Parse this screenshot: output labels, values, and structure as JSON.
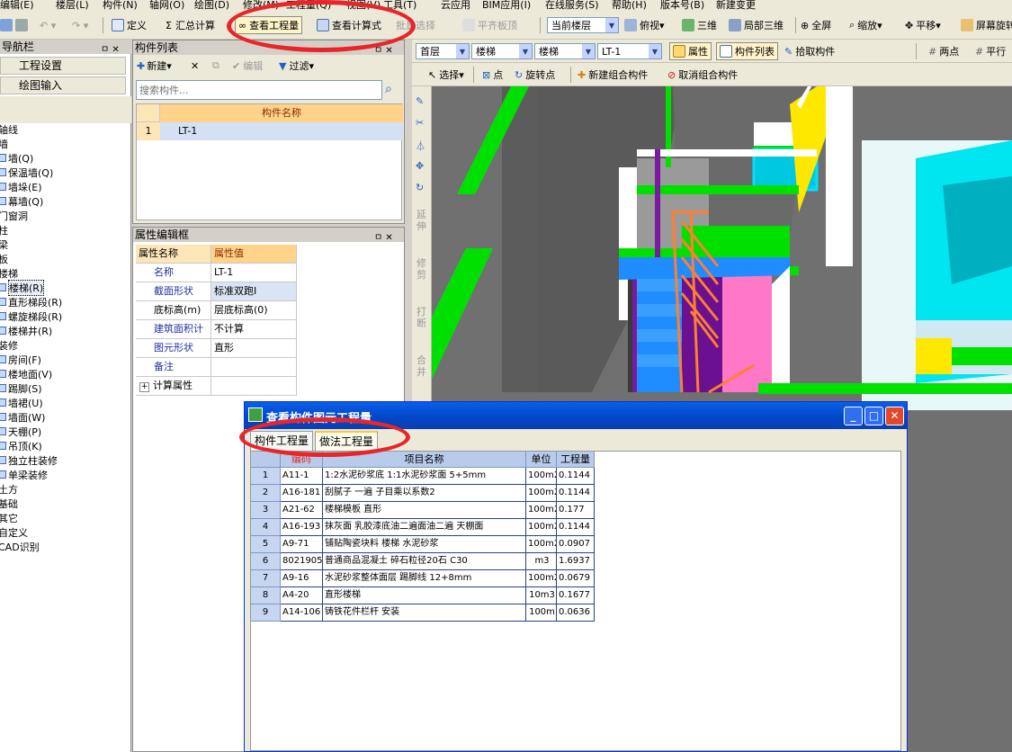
{
  "menubar": [
    "编辑(E)",
    "楼层(L)",
    "构件(N)",
    "轴网(O)",
    "绘图(D)",
    "修改(M)",
    "工程量(Q)",
    "视图(V)",
    "工具(T)",
    "云应用",
    "BIM应用(I)",
    "在线服务(S)",
    "帮助(H)",
    "版本号(B)",
    "新建变更"
  ],
  "toolbar1": {
    "define": "定义",
    "sum_calc": "汇总计算",
    "view_quantity": "查看工程量",
    "view_formula": "查看计算式",
    "batch_select": "批量选择",
    "align_top": "平齐板顶",
    "floor_combo": "当前楼层",
    "top_view": "俯视",
    "three_d": "三维",
    "local_3d": "局部三维",
    "fullscreen": "全屏",
    "zoom": "缩放",
    "pan": "平移",
    "screen_rotate": "屏幕旋转"
  },
  "toolbar2": {
    "floor": "首层",
    "cat1": "楼梯",
    "cat2": "楼梯",
    "component": "LT-1",
    "properties": "属性",
    "component_list": "构件列表",
    "pick_component": "拾取构件",
    "two_points": "两点",
    "parallel": "平行"
  },
  "toolbar3": {
    "select": "选择",
    "point": "点",
    "rotate_point": "旋转点",
    "new_combo": "新建组合构件",
    "cancel_combo": "取消组合构件"
  },
  "left_panel": {
    "title": "导航栏",
    "project_settings": "工程设置",
    "drawing_input": "绘图输入",
    "tree": [
      {
        "label": "轴线",
        "indent": 0,
        "icon": false
      },
      {
        "label": "墙",
        "indent": 0,
        "icon": false
      },
      {
        "label": "墙(Q)",
        "indent": 1,
        "icon": true
      },
      {
        "label": "保温墙(Q)",
        "indent": 1,
        "icon": true
      },
      {
        "label": "墙垛(E)",
        "indent": 1,
        "icon": true
      },
      {
        "label": "幕墙(Q)",
        "indent": 1,
        "icon": true
      },
      {
        "label": "门窗洞",
        "indent": 0,
        "icon": false
      },
      {
        "label": "柱",
        "indent": 0,
        "icon": false
      },
      {
        "label": "梁",
        "indent": 0,
        "icon": false
      },
      {
        "label": "板",
        "indent": 0,
        "icon": false
      },
      {
        "label": "楼梯",
        "indent": 0,
        "icon": false
      },
      {
        "label": "楼梯(R)",
        "indent": 1,
        "icon": true,
        "selected": true
      },
      {
        "label": "直形梯段(R)",
        "indent": 1,
        "icon": true
      },
      {
        "label": "螺旋梯段(R)",
        "indent": 1,
        "icon": true
      },
      {
        "label": "楼梯井(R)",
        "indent": 1,
        "icon": true
      },
      {
        "label": "装修",
        "indent": 0,
        "icon": false
      },
      {
        "label": "房间(F)",
        "indent": 1,
        "icon": true
      },
      {
        "label": "楼地面(V)",
        "indent": 1,
        "icon": true
      },
      {
        "label": "踢脚(S)",
        "indent": 1,
        "icon": true
      },
      {
        "label": "墙裙(U)",
        "indent": 1,
        "icon": true
      },
      {
        "label": "墙面(W)",
        "indent": 1,
        "icon": true
      },
      {
        "label": "天棚(P)",
        "indent": 1,
        "icon": true
      },
      {
        "label": "吊顶(K)",
        "indent": 1,
        "icon": true
      },
      {
        "label": "独立柱装修",
        "indent": 1,
        "icon": true
      },
      {
        "label": "单梁装修",
        "indent": 1,
        "icon": true
      },
      {
        "label": "土方",
        "indent": 0,
        "icon": false
      },
      {
        "label": "基础",
        "indent": 0,
        "icon": false
      },
      {
        "label": "其它",
        "indent": 0,
        "icon": false
      },
      {
        "label": "自定义",
        "indent": 0,
        "icon": false
      },
      {
        "label": "CAD识别",
        "indent": 0,
        "icon": false
      }
    ]
  },
  "component_list": {
    "title": "构件列表",
    "new": "新建",
    "edit": "编辑",
    "filter": "过滤",
    "search_placeholder": "搜索构件...",
    "header": "构件名称",
    "rows": [
      {
        "no": "1",
        "name": "LT-1"
      }
    ]
  },
  "property_editor": {
    "title": "属性编辑框",
    "col_name": "属性名称",
    "col_value": "属性值",
    "rows": [
      {
        "name": "名称",
        "value": "LT-1",
        "blue": true
      },
      {
        "name": "截面形状",
        "value": "标准双跑I",
        "blue": true
      },
      {
        "name": "底标高(m)",
        "value": "层底标高(0)",
        "blue": false
      },
      {
        "name": "建筑面积计",
        "value": "不计算",
        "blue": true
      },
      {
        "name": "图元形状",
        "value": "直形",
        "blue": true
      },
      {
        "name": "备注",
        "value": "",
        "blue": true
      },
      {
        "name": "计算属性",
        "value": "",
        "blue": false,
        "expander": "+"
      }
    ]
  },
  "vtools": [
    "延伸",
    "修剪",
    "打断",
    "合并"
  ],
  "dialog": {
    "title": "查看构件图元工程量",
    "tabs": [
      "构件工程量",
      "做法工程量"
    ],
    "active_tab": 1,
    "columns": [
      "编码",
      "项目名称",
      "单位",
      "工程量"
    ],
    "rows": [
      {
        "no": "1",
        "code": "A11-1",
        "name": "1:2水泥砂浆底 1:1水泥砂浆面 5+5mm",
        "unit": "100m2",
        "qty": "0.1144"
      },
      {
        "no": "2",
        "code": "A16-181",
        "name": "刮腻子 一遍 子目乘以系数2",
        "unit": "100m2",
        "qty": "0.1144"
      },
      {
        "no": "3",
        "code": "A21-62",
        "name": "楼梯模板 直形",
        "unit": "100m2",
        "qty": "0.177"
      },
      {
        "no": "4",
        "code": "A16-193",
        "name": "抹灰面 乳胶漆底油二遍面油二遍 天棚面",
        "unit": "100m2",
        "qty": "0.1144"
      },
      {
        "no": "5",
        "code": "A9-71",
        "name": "铺贴陶瓷块料 楼梯 水泥砂浆",
        "unit": "100m2",
        "qty": "0.0907"
      },
      {
        "no": "6",
        "code": "8021905",
        "name": "普通商品混凝土 碎石粒径20石 C30",
        "unit": "m3",
        "qty": "1.6937"
      },
      {
        "no": "7",
        "code": "A9-16",
        "name": "水泥砂浆整体面层 踢脚线 12+8mm",
        "unit": "100m2",
        "qty": "0.0679"
      },
      {
        "no": "8",
        "code": "A4-20",
        "name": "直形楼梯",
        "unit": "10m3",
        "qty": "0.1677"
      },
      {
        "no": "9",
        "code": "A14-106",
        "name": "铸铁花件栏杆 安装",
        "unit": "100m",
        "qty": "0.0636"
      }
    ]
  },
  "colors": {
    "accent_red": "#e8262a",
    "xp_blue": "#0246c8",
    "cad_green": "#00e000",
    "cad_cyan": "#00f0ff",
    "cad_blue": "#1f8cff",
    "cad_purple": "#7a1aa0"
  }
}
